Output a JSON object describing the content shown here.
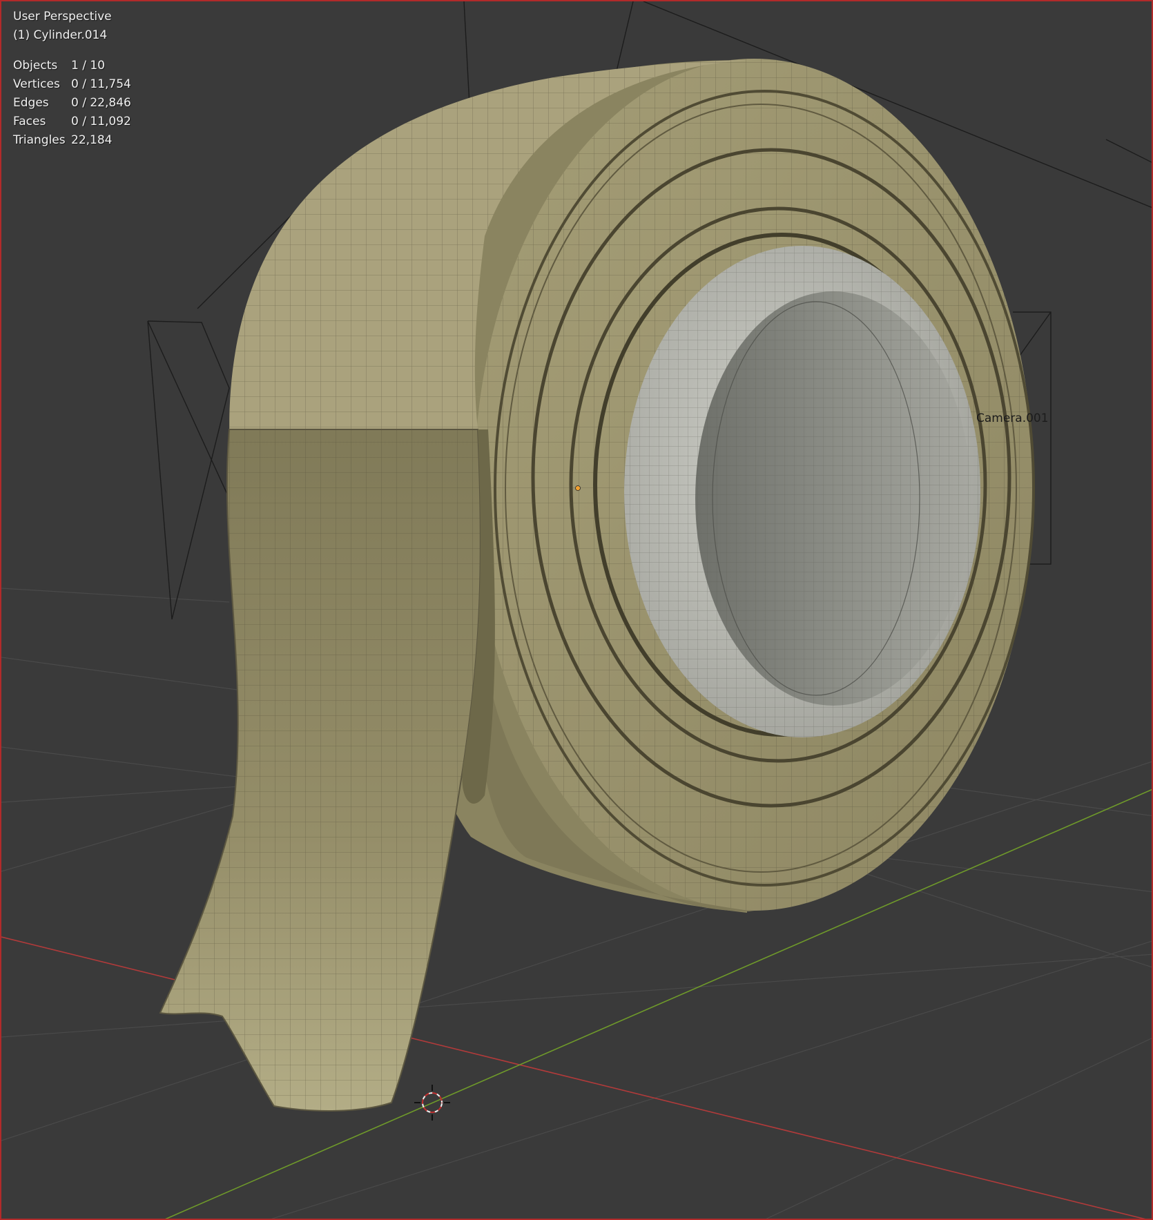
{
  "viewport": {
    "view_name": "User Perspective",
    "active_object": "(1) Cylinder.014",
    "camera_label": "Camera.001",
    "stats": [
      {
        "key": "Objects",
        "value": "1 / 10"
      },
      {
        "key": "Vertices",
        "value": "0 / 11,754"
      },
      {
        "key": "Edges",
        "value": "0 / 22,846"
      },
      {
        "key": "Faces",
        "value": "0 / 11,092"
      },
      {
        "key": "Triangles",
        "value": "22,184"
      }
    ]
  },
  "colors": {
    "background": "#3a3a3a",
    "tape": "#a9a27a",
    "tape_dark": "#7c7655",
    "core": "#b8b9b2",
    "x_axis": "#b23a3a",
    "y_axis": "#6f9a2a",
    "border": "#b22a2a"
  }
}
